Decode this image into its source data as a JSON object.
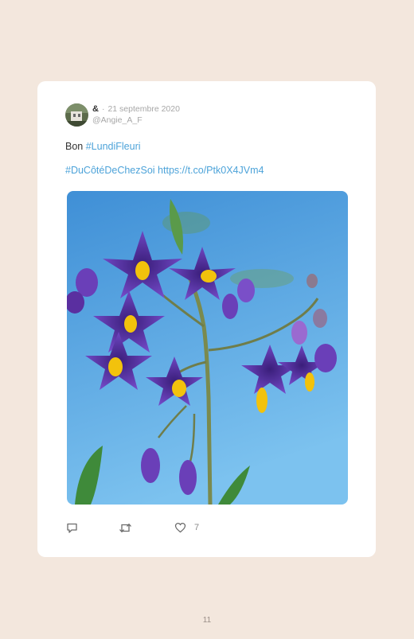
{
  "tweet": {
    "author_name": "&",
    "separator": "·",
    "date": "21 septembre 2020",
    "handle": "@Angie_A_F",
    "text_prefix": "Bon ",
    "hashtag1": "#LundiFleuri",
    "hashtag2": "#DuCôtéDeChezSoi",
    "url": "https://t.co/Ptk0X4JVm4",
    "media_description": "purple-flowers-photo",
    "like_count": "7"
  },
  "icons": {
    "reply": "reply-icon",
    "retweet": "retweet-icon",
    "like": "heart-icon"
  },
  "colors": {
    "page_background": "#f3e7dd",
    "card_background": "#ffffff",
    "link": "#4da3d9",
    "muted_text": "#a7a7a7"
  },
  "footer": {
    "page_number": "11"
  }
}
